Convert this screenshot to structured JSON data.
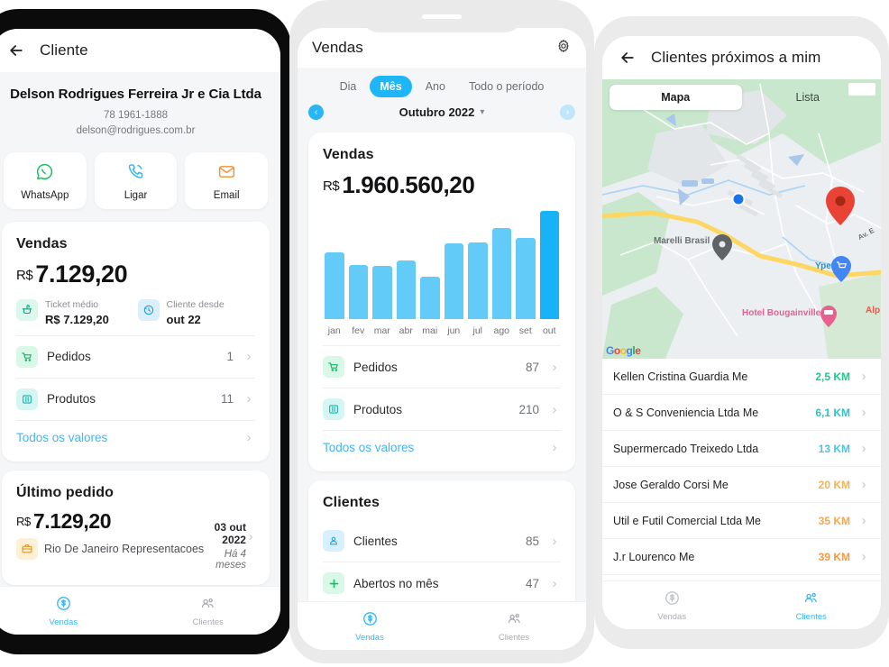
{
  "phone1": {
    "appbar": {
      "title": "Cliente",
      "back_icon": "arrow-left-icon"
    },
    "client": {
      "name": "Delson Rodrigues Ferreira Jr e Cia Ltda",
      "phone": "78 1961-1888",
      "email": "delson@rodrigues.com.br"
    },
    "actions": [
      {
        "label": "WhatsApp",
        "icon": "whatsapp-icon",
        "color": "#18c15d"
      },
      {
        "label": "Ligar",
        "icon": "phone-call-icon",
        "color": "#31b6f3"
      },
      {
        "label": "Email",
        "icon": "envelope-icon",
        "color": "#f0922f"
      }
    ],
    "sales_card": {
      "title": "Vendas",
      "currency": "R$",
      "amount": "7.129,20",
      "kpis": [
        {
          "label": "Ticket médio",
          "value": "R$ 7.129,20",
          "icon": "ticket-icon"
        },
        {
          "label": "Cliente desde",
          "value": "out 22",
          "icon": "history-clock-icon"
        }
      ],
      "rows": [
        {
          "label": "Pedidos",
          "value": "1",
          "icon": "cart-icon"
        },
        {
          "label": "Produtos",
          "value": "11",
          "icon": "box-icon"
        }
      ],
      "link": "Todos os valores"
    },
    "last_order": {
      "title": "Último pedido",
      "currency": "R$",
      "amount": "7.129,20",
      "company": "Rio De Janeiro Representacoes",
      "company_icon": "briefcase-icon",
      "date": "03 out 2022",
      "ago": "Há 4 meses"
    },
    "bottom_nav": [
      {
        "label": "Vendas",
        "icon": "dollar-circle-icon",
        "active": true
      },
      {
        "label": "Clientes",
        "icon": "people-icon",
        "active": false
      }
    ]
  },
  "phone2": {
    "appbar": {
      "title": "Vendas",
      "settings_icon": "gear-icon"
    },
    "segments": [
      {
        "label": "Dia",
        "active": false
      },
      {
        "label": "Mês",
        "active": true
      },
      {
        "label": "Ano",
        "active": false
      },
      {
        "label": "Todo o período",
        "active": false
      }
    ],
    "period": {
      "prev_icon": "chevron-left-circle-icon",
      "next_icon": "chevron-right-circle-icon",
      "label": "Outubro 2022",
      "dropdown_icon": "chevron-down-icon"
    },
    "sales_card": {
      "title": "Vendas",
      "currency": "R$",
      "amount": "1.960.560,20",
      "rows": [
        {
          "label": "Pedidos",
          "value": "87",
          "icon": "cart-icon"
        },
        {
          "label": "Produtos",
          "value": "210",
          "icon": "box-icon"
        }
      ],
      "link": "Todos os valores"
    },
    "clients_card": {
      "title": "Clientes",
      "rows": [
        {
          "label": "Clientes",
          "value": "85",
          "icon": "person-icon"
        },
        {
          "label": "Abertos no mês",
          "value": "47",
          "icon": "plus-icon"
        }
      ]
    },
    "bottom_nav": [
      {
        "label": "Vendas",
        "icon": "dollar-circle-icon",
        "active": true
      },
      {
        "label": "Clientes",
        "icon": "people-icon",
        "active": false
      }
    ]
  },
  "chart_data": {
    "type": "bar",
    "title": "Vendas",
    "categories": [
      "jan",
      "fev",
      "mar",
      "abr",
      "mai",
      "jun",
      "jul",
      "ago",
      "set",
      "out"
    ],
    "values": [
      62,
      50,
      49,
      54,
      39,
      70,
      71,
      84,
      75,
      100
    ],
    "highlight_index": 9,
    "colors": {
      "bar": "#63cbf8",
      "bar_highlight": "#18b2f7"
    },
    "xlabel": "",
    "ylabel": "",
    "ylim": [
      0,
      100
    ],
    "grid": false,
    "legend": false,
    "value_label": "R$ 1.960.560,20"
  },
  "phone3": {
    "appbar": {
      "title": "Clientes próximos a mim",
      "back_icon": "arrow-left-icon"
    },
    "tabs": [
      {
        "label": "Mapa",
        "active": true
      },
      {
        "label": "Lista",
        "active": false
      }
    ],
    "map": {
      "provider_logo": "Google",
      "pin_icon": "map-pin-icon",
      "user_dot_icon": "user-location-dot-icon",
      "labels": [
        {
          "text": "Marelli Brasil",
          "color": "#5f6368"
        },
        {
          "text": "Ype",
          "color": "#2196c9"
        },
        {
          "text": "Hotel Bougainville",
          "color": "#e8608f"
        },
        {
          "text": "Alp",
          "color": "#e05a4e"
        },
        {
          "text": "Av. E",
          "color": "#84888d"
        }
      ]
    },
    "clients": [
      {
        "name": "Kellen Cristina Guardia Me",
        "distance": "2,5 KM",
        "color": "#1ec98e"
      },
      {
        "name": "O & S Conveniencia Ltda Me",
        "distance": "6,1 KM",
        "color": "#2ec1c9"
      },
      {
        "name": "Supermercado Treixedo Ltda",
        "distance": "13 KM",
        "color": "#4cc4e0"
      },
      {
        "name": "Jose Geraldo Corsi Me",
        "distance": "20 KM",
        "color": "#f5b355"
      },
      {
        "name": "Util e Futil Comercial Ltda Me",
        "distance": "35 KM",
        "color": "#f5a84f"
      },
      {
        "name": "J.r Lourenco Me",
        "distance": "39 KM",
        "color": "#f59a45"
      }
    ],
    "bottom_nav": [
      {
        "label": "Vendas",
        "icon": "dollar-circle-icon",
        "active": false
      },
      {
        "label": "Clientes",
        "icon": "people-icon",
        "active": true
      }
    ]
  },
  "theme": {
    "accent": "#29b6f6",
    "green": "#18c15d",
    "orange": "#f0922f",
    "page_bg": "#f5f6f8"
  }
}
